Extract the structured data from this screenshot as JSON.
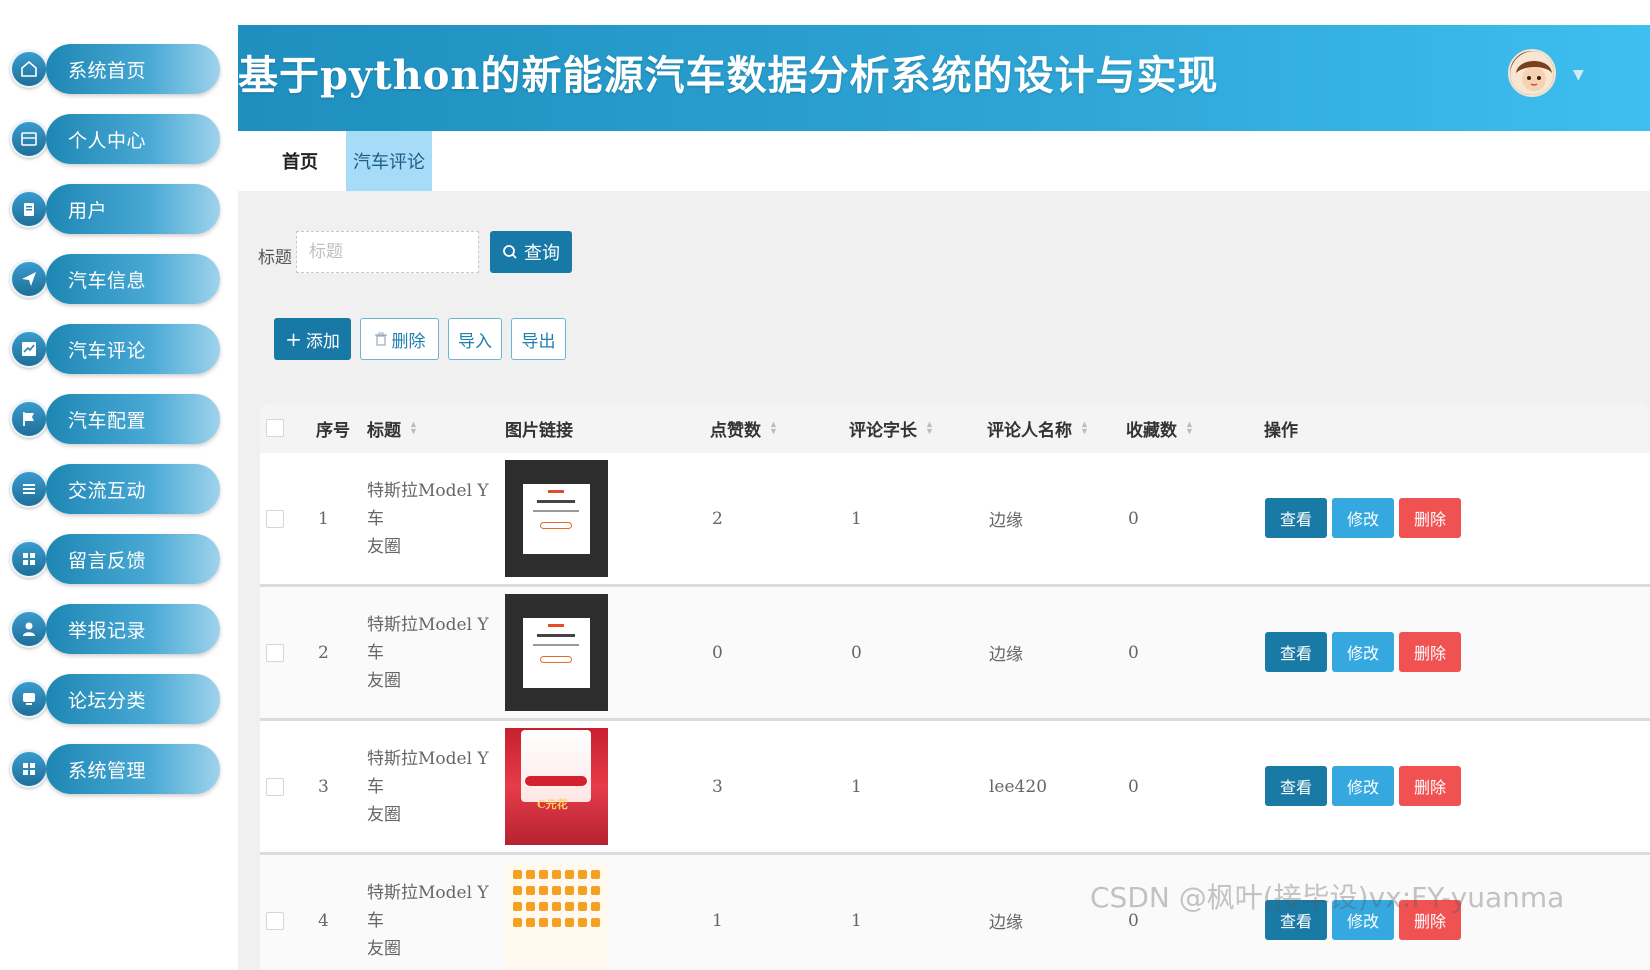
{
  "sidebar": {
    "items": [
      {
        "label": "系统首页",
        "icon": "home-icon"
      },
      {
        "label": "个人中心",
        "icon": "user-card-icon"
      },
      {
        "label": "用户",
        "icon": "clipboard-icon"
      },
      {
        "label": "汽车信息",
        "icon": "send-icon"
      },
      {
        "label": "汽车评论",
        "icon": "chart-icon"
      },
      {
        "label": "汽车配置",
        "icon": "flag-icon"
      },
      {
        "label": "交流互动",
        "icon": "list-icon"
      },
      {
        "label": "留言反馈",
        "icon": "grid-icon"
      },
      {
        "label": "举报记录",
        "icon": "person-icon"
      },
      {
        "label": "论坛分类",
        "icon": "chat-icon"
      },
      {
        "label": "系统管理",
        "icon": "grid-icon"
      }
    ]
  },
  "header": {
    "title": "基于python的新能源汽车数据分析系统的设计与实现",
    "avatar_icon": "avatar-icon",
    "dropdown_icon": "caret-down-icon"
  },
  "tabs": [
    {
      "label": "首页"
    },
    {
      "label": "汽车评论"
    }
  ],
  "search": {
    "label": "标题",
    "placeholder": "标题",
    "button_label": "查询"
  },
  "toolbar": {
    "add_label": "添加",
    "delete_label": "删除",
    "import_label": "导入",
    "export_label": "导出"
  },
  "table": {
    "columns": [
      "序号",
      "标题",
      "图片链接",
      "点赞数",
      "评论字长",
      "评论人名称",
      "收藏数",
      "操作"
    ],
    "rows": [
      {
        "index": "1",
        "title_line1": "特斯拉Model Y车",
        "title_line2": "友圈",
        "likes": "2",
        "length": "1",
        "commenter": "边缘",
        "favorites": "0"
      },
      {
        "index": "2",
        "title_line1": "特斯拉Model Y车",
        "title_line2": "友圈",
        "likes": "0",
        "length": "0",
        "commenter": "边缘",
        "favorites": "0"
      },
      {
        "index": "3",
        "title_line1": "特斯拉Model Y车",
        "title_line2": "友圈",
        "likes": "3",
        "length": "1",
        "commenter": "lee420",
        "favorites": "0"
      },
      {
        "index": "4",
        "title_line1": "特斯拉Model Y车",
        "title_line2": "友圈",
        "likes": "1",
        "length": "1",
        "commenter": "边缘",
        "favorites": "0"
      }
    ],
    "actions": {
      "view": "查看",
      "edit": "修改",
      "delete": "删除"
    }
  },
  "watermark": "CSDN @枫叶(接毕设)vx:FY-yuanma",
  "colors": {
    "primary": "#1878a6",
    "header": "#2fa6d6",
    "tab_active": "#a6dcf7",
    "danger": "#f05252",
    "edit": "#35a8e0"
  }
}
